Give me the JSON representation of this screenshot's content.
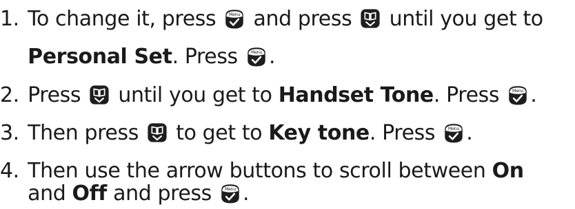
{
  "steps": [
    {
      "number": "1.",
      "line1": {
        "t1": "To change it, press",
        "t2": "and press",
        "t3": "until you get to"
      },
      "line2": {
        "b1": "Personal Set",
        "t1": ". Press",
        "t2": "."
      }
    },
    {
      "number": "2.",
      "t1": "Press",
      "t2": "until you get to",
      "b1": "Handset Tone",
      "t3": ". Press",
      "t4": "."
    },
    {
      "number": "3.",
      "t1": "Then press",
      "t2": "to get to",
      "b1": "Key tone",
      "t3": ". Press",
      "t4": "."
    },
    {
      "number": "4.",
      "line1": {
        "t1": "Then use the arrow buttons to scroll between",
        "b1": "On"
      },
      "line2": {
        "t1": "and",
        "b1": "Off",
        "t2": "and press",
        "t3": "."
      }
    }
  ],
  "icons": {
    "menu_key_label": "Menu",
    "menu_key_icon": "menu-check-key-icon",
    "phonebook_key_icon": "phonebook-scroll-key-icon",
    "key_color": "#1e1e1e"
  }
}
